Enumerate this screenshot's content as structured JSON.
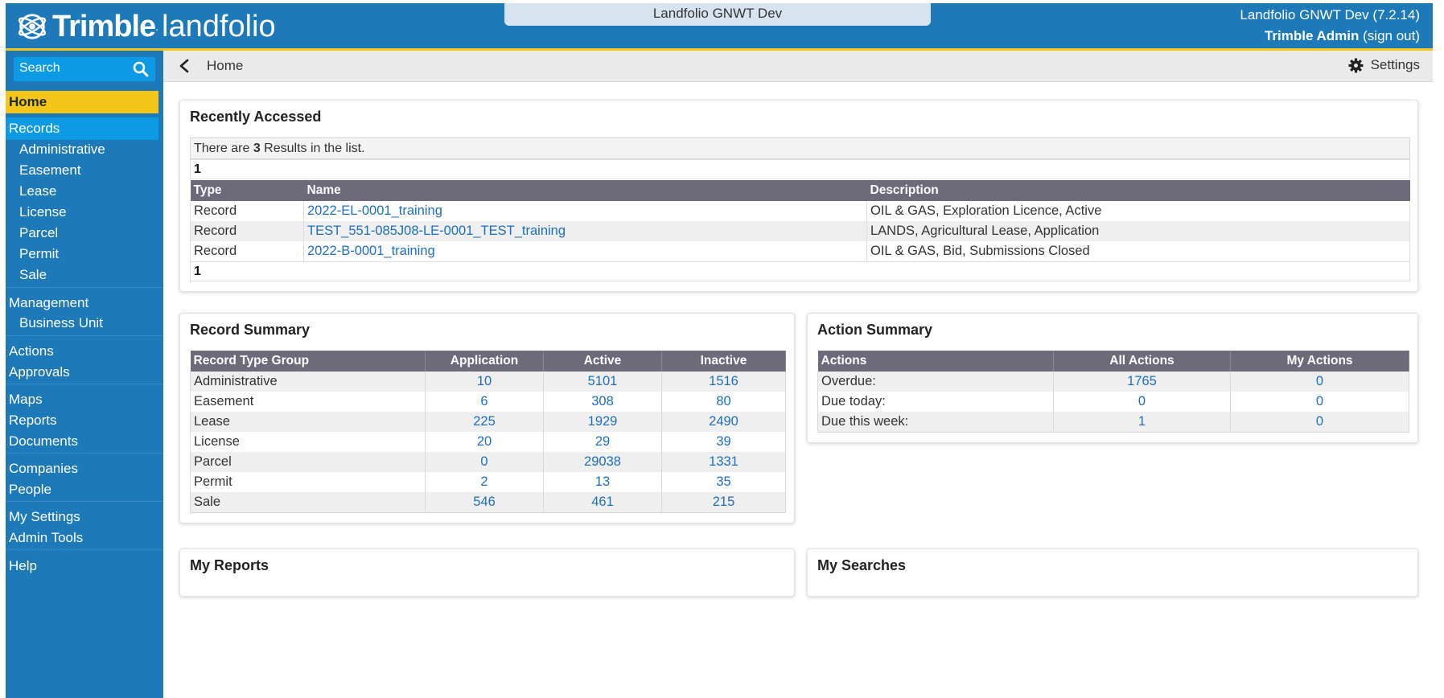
{
  "header": {
    "brand": "Trimble",
    "product": "landfolio",
    "env_tab": "Landfolio GNWT Dev",
    "env_version": "Landfolio GNWT Dev (7.2.14)",
    "user": "Trimble Admin",
    "sign_out": "(sign out)"
  },
  "sidebar": {
    "search_placeholder": "Search",
    "items": [
      {
        "label": "Home",
        "active": true
      },
      {
        "label": "Records"
      },
      {
        "label": "Administrative",
        "sub": true
      },
      {
        "label": "Easement",
        "sub": true
      },
      {
        "label": "Lease",
        "sub": true
      },
      {
        "label": "License",
        "sub": true
      },
      {
        "label": "Parcel",
        "sub": true
      },
      {
        "label": "Permit",
        "sub": true
      },
      {
        "label": "Sale",
        "sub": true
      },
      {
        "label": "Management"
      },
      {
        "label": "Business Unit",
        "sub": true
      },
      {
        "label": "Actions"
      },
      {
        "label": "Approvals"
      },
      {
        "label": "Maps"
      },
      {
        "label": "Reports"
      },
      {
        "label": "Documents"
      },
      {
        "label": "Companies"
      },
      {
        "label": "People"
      },
      {
        "label": "My Settings"
      },
      {
        "label": "Admin Tools"
      },
      {
        "label": "Help"
      }
    ]
  },
  "toolbar": {
    "breadcrumb": "Home",
    "settings": "Settings"
  },
  "recent": {
    "title": "Recently Accessed",
    "info_prefix": "There are ",
    "info_count": "3",
    "info_suffix": " Results in the list.",
    "page": "1",
    "columns": [
      "Type",
      "Name",
      "Description"
    ],
    "rows": [
      {
        "type": "Record",
        "name": "2022-EL-0001_training",
        "description": "OIL & GAS, Exploration Licence, Active"
      },
      {
        "type": "Record",
        "name": "TEST_551-085J08-LE-0001_TEST_training",
        "description": "LANDS, Agricultural Lease, Application"
      },
      {
        "type": "Record",
        "name": "2022-B-0001_training",
        "description": "OIL & GAS, Bid, Submissions Closed"
      }
    ]
  },
  "record_summary": {
    "title": "Record Summary",
    "columns": [
      "Record Type Group",
      "Application",
      "Active",
      "Inactive"
    ],
    "rows": [
      {
        "group": "Administrative",
        "application": "10",
        "active": "5101",
        "inactive": "1516"
      },
      {
        "group": "Easement",
        "application": "6",
        "active": "308",
        "inactive": "80"
      },
      {
        "group": "Lease",
        "application": "225",
        "active": "1929",
        "inactive": "2490"
      },
      {
        "group": "License",
        "application": "20",
        "active": "29",
        "inactive": "39"
      },
      {
        "group": "Parcel",
        "application": "0",
        "active": "29038",
        "inactive": "1331"
      },
      {
        "group": "Permit",
        "application": "2",
        "active": "13",
        "inactive": "35"
      },
      {
        "group": "Sale",
        "application": "546",
        "active": "461",
        "inactive": "215"
      }
    ]
  },
  "action_summary": {
    "title": "Action Summary",
    "columns": [
      "Actions",
      "All Actions",
      "My Actions"
    ],
    "rows": [
      {
        "label": "Overdue:",
        "all": "1765",
        "mine": "0"
      },
      {
        "label": "Due today:",
        "all": "0",
        "mine": "0"
      },
      {
        "label": "Due this week:",
        "all": "1",
        "mine": "0"
      }
    ]
  },
  "my_reports": {
    "title": "My Reports"
  },
  "my_searches": {
    "title": "My Searches"
  },
  "colors": {
    "header_blue": "#1e79b8",
    "accent_yellow": "#f4c619",
    "table_header": "#6d6a7a",
    "link": "#1e6fc0"
  }
}
